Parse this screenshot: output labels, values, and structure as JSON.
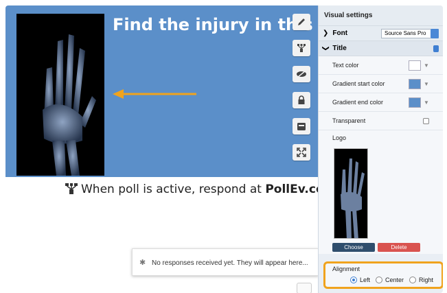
{
  "slide": {
    "title": "Find the injury in this x-ray",
    "respond_prefix": "When poll is active, respond at ",
    "respond_url": "PollEv.com/jake",
    "no_responses": "No responses received yet. They will appear here..."
  },
  "panel": {
    "title": "Visual settings",
    "font_label": "Font",
    "font_value": "Source Sans Pro",
    "title_section_label": "Title",
    "text_color_label": "Text color",
    "gradient_start_label": "Gradient start color",
    "gradient_end_label": "Gradient end color",
    "transparent_label": "Transparent",
    "logo_label": "Logo",
    "choose_label": "Choose",
    "delete_label": "Delete",
    "alignment_label": "Alignment",
    "align_left": "Left",
    "align_center": "Center",
    "align_right": "Right"
  },
  "colors": {
    "header_bg": "#5b8fc9",
    "accent": "#f0a31d",
    "text_color_swatch": "#ffffff",
    "gradient_start_swatch": "#5b8fc9",
    "gradient_end_swatch": "#5b8fc9"
  },
  "icons": [
    "pencil-icon",
    "poll-icon",
    "hide-icon",
    "lock-icon",
    "archive-icon",
    "fullscreen-icon"
  ]
}
